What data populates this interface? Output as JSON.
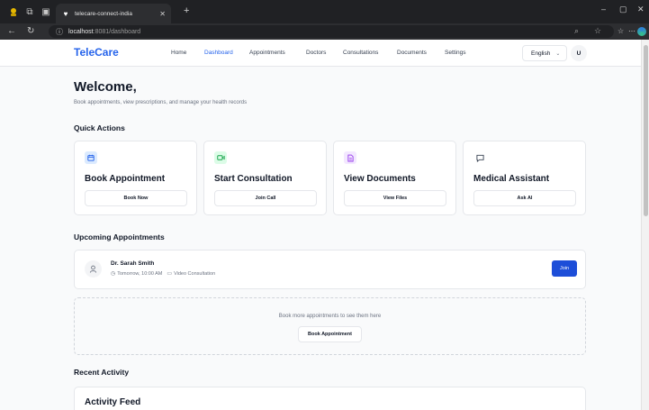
{
  "browser": {
    "tab_title": "telecare-connect-india",
    "url_host": "localhost",
    "url_rest": ":8081/dashboard"
  },
  "app": {
    "logo": "TeleCare",
    "nav": [
      {
        "label": "Home",
        "active": false
      },
      {
        "label": "Dashboard",
        "active": true
      },
      {
        "label": "Appointments",
        "active": false
      },
      {
        "label": "Doctors",
        "active": false
      },
      {
        "label": "Consultations",
        "active": false
      },
      {
        "label": "Documents",
        "active": false
      },
      {
        "label": "Settings",
        "active": false
      }
    ],
    "language": "English",
    "user_initial": "U"
  },
  "welcome": {
    "title": "Welcome,",
    "subtitle": "Book appointments, view prescriptions, and manage your health records"
  },
  "quick_actions": {
    "title": "Quick Actions",
    "cards": [
      {
        "title": "Book Appointment",
        "button": "Book Now",
        "icon": "calendar-icon",
        "accent": "#2563eb",
        "icon_bg": "#dbeafe"
      },
      {
        "title": "Start Consultation",
        "button": "Join Call",
        "icon": "video-icon",
        "accent": "#16a34a",
        "icon_bg": "#dcfce7"
      },
      {
        "title": "View Documents",
        "button": "View Files",
        "icon": "file-icon",
        "accent": "#9333ea",
        "icon_bg": "#f3e8ff"
      },
      {
        "title": "Medical Assistant",
        "button": "Ask AI",
        "icon": "chat-icon",
        "accent": "#374151",
        "icon_bg": "#ffffff"
      }
    ]
  },
  "upcoming": {
    "title": "Upcoming Appointments",
    "appointment": {
      "doctor": "Dr. Sarah Smith",
      "time": "Tomorrow, 10:00 AM",
      "type": "Video Consultation",
      "join_label": "Join"
    },
    "more_text": "Book more appointments to see them here",
    "more_button": "Book Appointment"
  },
  "recent": {
    "title": "Recent Activity",
    "feed_title": "Activity Feed"
  },
  "colors": {
    "brand": "#2563eb",
    "primary_button": "#1d4ed8"
  }
}
